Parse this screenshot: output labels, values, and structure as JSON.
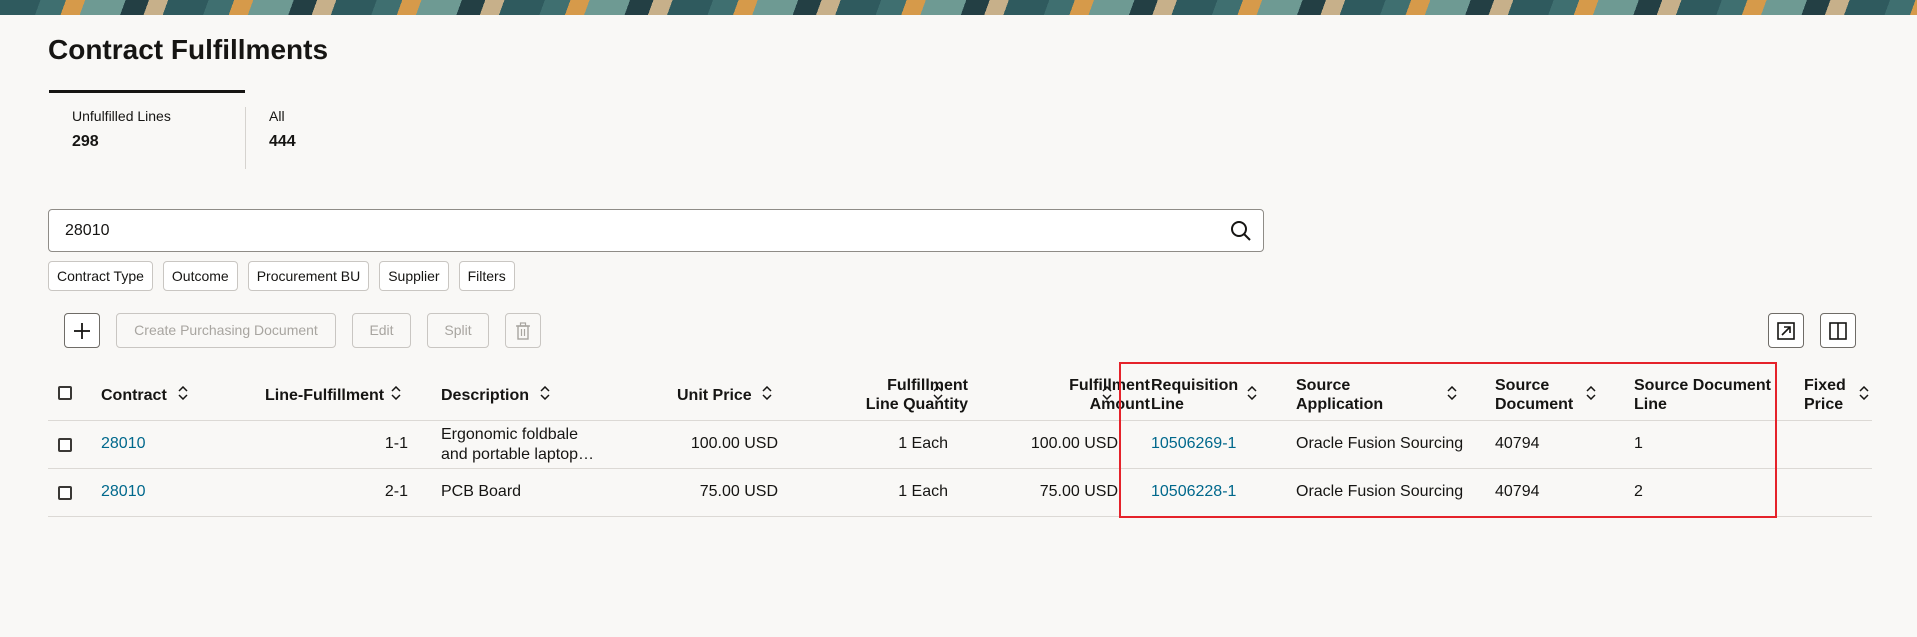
{
  "page": {
    "title": "Contract Fulfillments"
  },
  "tabs": [
    {
      "label": "Unfulfilled Lines",
      "count": "298"
    },
    {
      "label": "All",
      "count": "444"
    }
  ],
  "search": {
    "value": "28010"
  },
  "filters": [
    "Contract Type",
    "Outcome",
    "Procurement BU",
    "Supplier",
    "Filters"
  ],
  "toolbar": {
    "create_label": "Create Purchasing Document",
    "edit_label": "Edit",
    "split_label": "Split"
  },
  "table": {
    "columns": {
      "contract": "Contract",
      "line_fulfillment": "Line-Fulfillment",
      "description": "Description",
      "unit_price": "Unit Price",
      "fulfillment_qty_1": "Fulfillment",
      "fulfillment_qty_2": "Line Quantity",
      "fulfillment_amt_1": "Fulfillment",
      "fulfillment_amt_2": "Amount",
      "req_line_1": "Requisition",
      "req_line_2": "Line",
      "source_app_1": "Source",
      "source_app_2": "Application",
      "source_doc_1": "Source",
      "source_doc_2": "Document",
      "source_doc_line_1": "Source Document",
      "source_doc_line_2": "Line",
      "fixed_price_1": "Fixed",
      "fixed_price_2": "Price"
    },
    "rows": [
      {
        "contract": "28010",
        "line_fulfillment": "1-1",
        "description_1": "Ergonomic foldbale",
        "description_2": "and portable laptop…",
        "unit_price": "100.00 USD",
        "quantity": "1 Each",
        "amount": "100.00 USD",
        "requisition_line": "10506269-1",
        "source_application": "Oracle Fusion Sourcing",
        "source_document": "40794",
        "source_document_line": "1"
      },
      {
        "contract": "28010",
        "line_fulfillment": "2-1",
        "description_1": "PCB Board",
        "unit_price": "75.00 USD",
        "quantity": "1 Each",
        "amount": "75.00 USD",
        "requisition_line": "10506228-1",
        "source_application": "Oracle Fusion Sourcing",
        "source_document": "40794",
        "source_document_line": "2"
      }
    ]
  },
  "colors": {
    "link": "#00688c",
    "highlight": "#e5222a"
  }
}
